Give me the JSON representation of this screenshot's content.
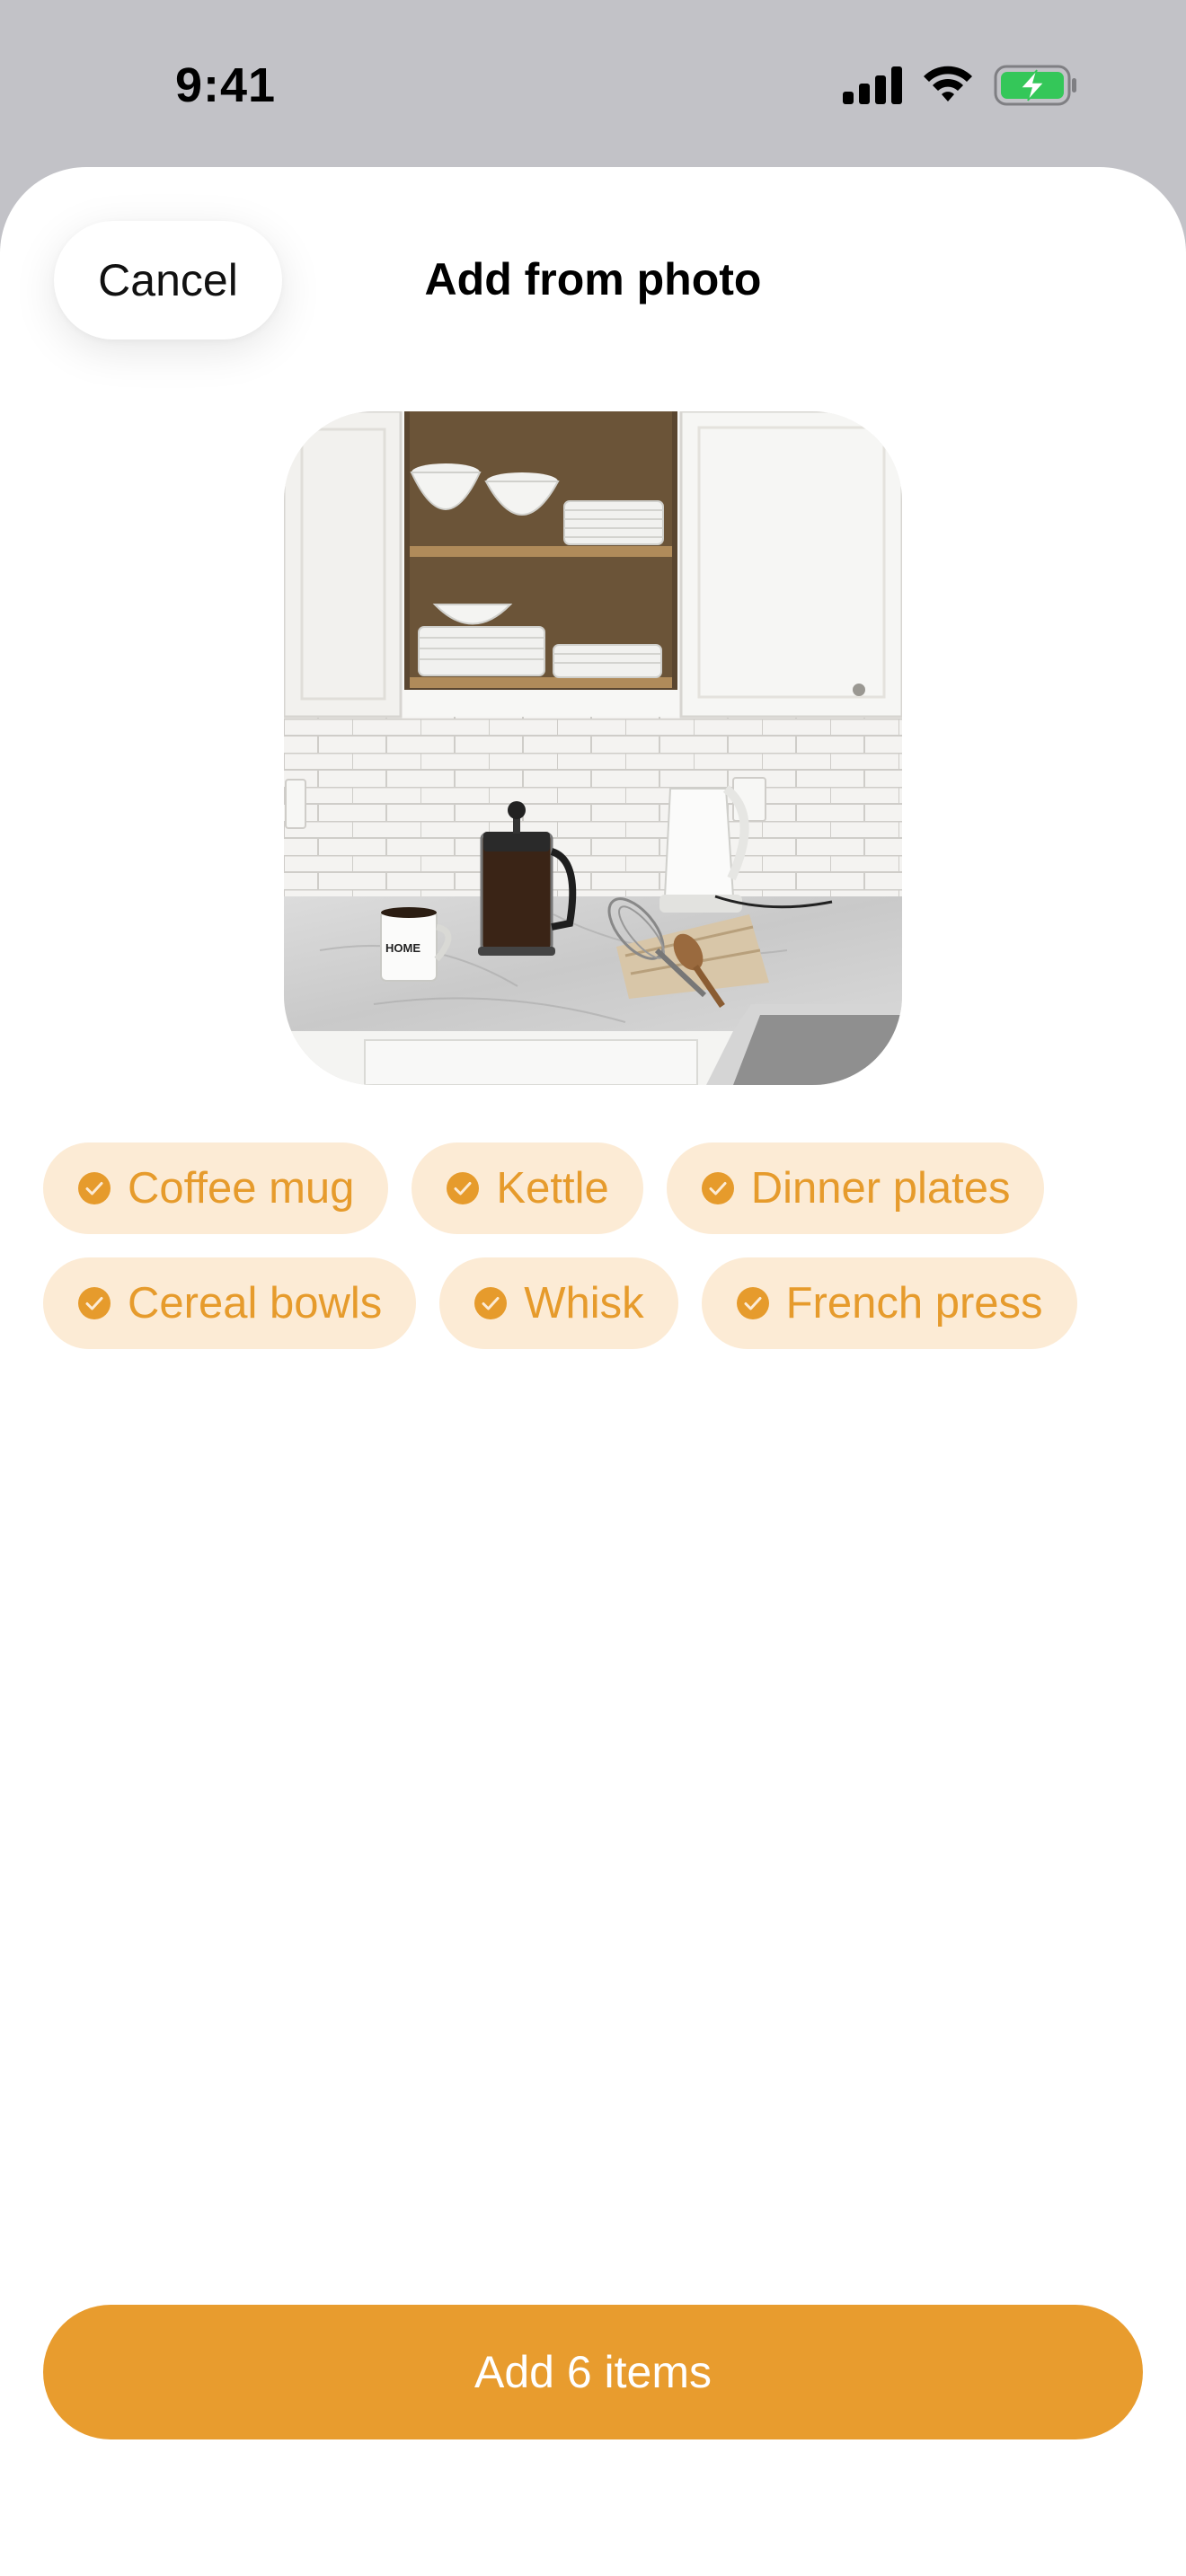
{
  "status_bar": {
    "time": "9:41",
    "icons": [
      "cellular-signal-icon",
      "wifi-icon",
      "battery-charging-icon"
    ],
    "battery_color": "#34c759"
  },
  "nav": {
    "cancel_label": "Cancel",
    "title": "Add from photo"
  },
  "photo": {
    "mug_text": "HOME"
  },
  "chips": [
    {
      "label": "Coffee mug",
      "selected": true
    },
    {
      "label": "Kettle",
      "selected": true
    },
    {
      "label": "Dinner plates",
      "selected": true
    },
    {
      "label": "Cereal bowls",
      "selected": true
    },
    {
      "label": "Whisk",
      "selected": true
    },
    {
      "label": "French press",
      "selected": true
    }
  ],
  "primary_action": {
    "label": "Add 6 items"
  },
  "colors": {
    "accent": "#e89c2e",
    "chip_background": "#fcebd5",
    "chip_text": "#e69b2c",
    "backdrop": "#c2c2c7"
  }
}
